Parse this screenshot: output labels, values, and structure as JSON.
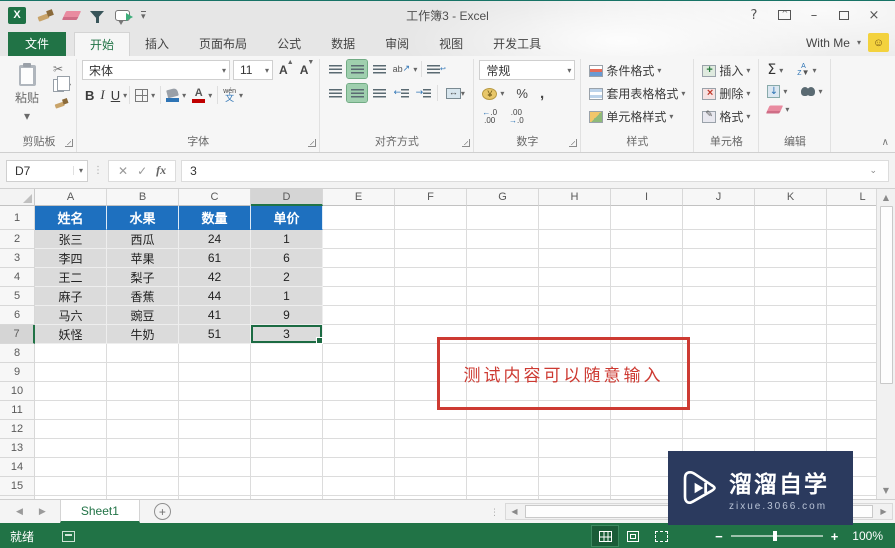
{
  "window": {
    "title": "工作簿3 - Excel"
  },
  "quick_access": {
    "icons": [
      "excel-logo",
      "format-painter-brush",
      "eraser",
      "filter-funnel",
      "screen-callout",
      "customize-arrow"
    ]
  },
  "account": {
    "label": "With Me"
  },
  "tabs": {
    "file": "文件",
    "active": "开始",
    "items": [
      "开始",
      "插入",
      "页面布局",
      "公式",
      "数据",
      "审阅",
      "视图",
      "开发工具"
    ]
  },
  "ribbon": {
    "clipboard": {
      "label": "剪贴板",
      "paste": "粘贴"
    },
    "font": {
      "label": "字体",
      "name": "宋体",
      "size": "11"
    },
    "alignment": {
      "label": "对齐方式"
    },
    "number": {
      "label": "数字",
      "format": "常规"
    },
    "styles": {
      "label": "样式",
      "conditional": "条件格式",
      "format_as_table": "套用表格格式",
      "cell_styles": "单元格样式"
    },
    "cells": {
      "label": "单元格",
      "insert": "插入",
      "delete": "删除",
      "format": "格式"
    },
    "editing": {
      "label": "编辑"
    }
  },
  "formula_bar": {
    "name_box": "D7",
    "value": "3"
  },
  "grid": {
    "columns": [
      "A",
      "B",
      "C",
      "D",
      "E",
      "F",
      "G",
      "H",
      "I",
      "J",
      "K",
      "L"
    ],
    "row_count": 16,
    "selected_cell": "D7",
    "selected_column": "D",
    "selected_row": 7,
    "table": {
      "headers": [
        "姓名",
        "水果",
        "数量",
        "单价"
      ],
      "rows": [
        [
          "张三",
          "西瓜",
          "24",
          "1"
        ],
        [
          "李四",
          "苹果",
          "61",
          "6"
        ],
        [
          "王二",
          "梨子",
          "42",
          "2"
        ],
        [
          "麻子",
          "香蕉",
          "44",
          "1"
        ],
        [
          "马六",
          "豌豆",
          "41",
          "9"
        ],
        [
          "妖怪",
          "牛奶",
          "51",
          "3"
        ]
      ]
    },
    "annotation": {
      "text": "测试内容可以随意输入",
      "color": "#cd3a32"
    }
  },
  "watermark": {
    "name": "溜溜自学",
    "site": "zixue.3066.com",
    "bg": "#2b3a5e"
  },
  "sheet_bar": {
    "active_sheet": "Sheet1"
  },
  "status_bar": {
    "ready": "就绪",
    "zoom": "100%"
  },
  "colors": {
    "brand_green": "#217346",
    "table_header_blue": "#1e70bf",
    "cell_fill": "#dbdbdb",
    "annotation_red": "#cd3a32"
  }
}
